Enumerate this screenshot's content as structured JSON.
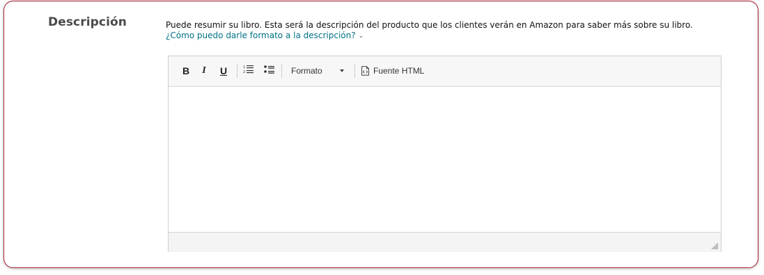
{
  "section": {
    "title": "Descripción",
    "description": "Puede resumir su libro. Esta será la descripción del producto que los clientes verán en Amazon para saber más sobre su libro.",
    "help_link": "¿Cómo puedo darle formato a la descripción?"
  },
  "toolbar": {
    "bold": "B",
    "italic": "I",
    "underline": "U",
    "format_label": "Formato",
    "source_label": "Fuente HTML"
  },
  "icons": {
    "numbered_list": "numbered-list-icon",
    "bulleted_list": "bulleted-list-icon",
    "dropdown": "caret-down-icon",
    "source": "html-source-icon",
    "help_chevron": "chevron-down-icon",
    "resize": "resize-handle-icon"
  },
  "colors": {
    "card_border": "#a8202e",
    "link": "#007185",
    "toolbar_bg": "#f7f7f7"
  },
  "editor": {
    "content": ""
  }
}
